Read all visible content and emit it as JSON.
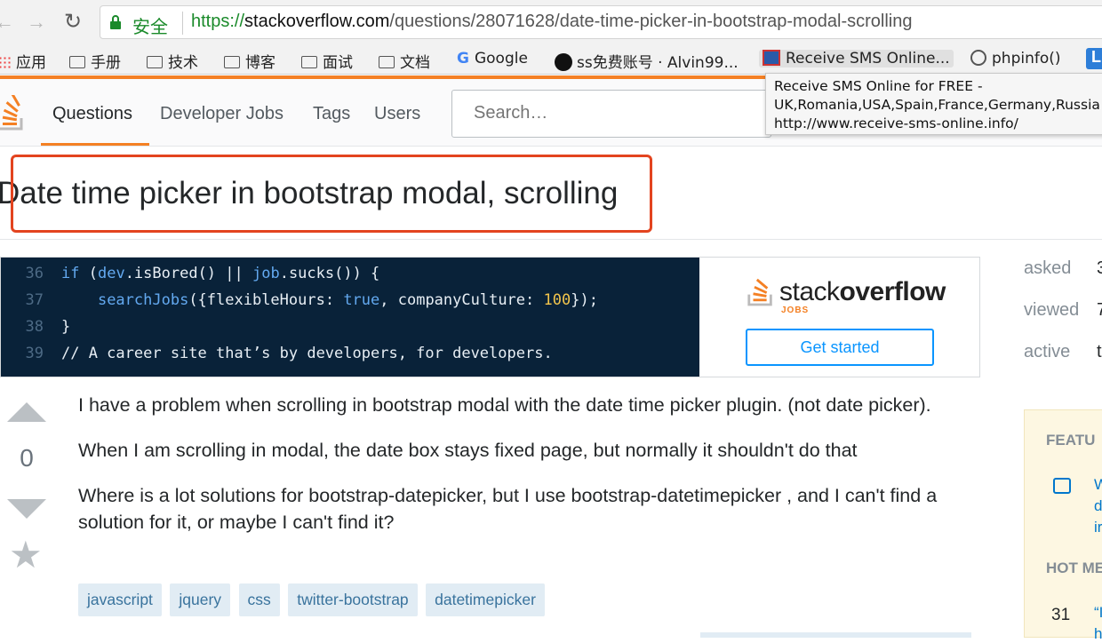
{
  "browser": {
    "secure_label": "安全",
    "url_scheme": "https://",
    "url_host": "stackoverflow.com",
    "url_path": "/questions/28071628/date-time-picker-in-bootstrap-modal-scrolling",
    "bookmarks": [
      "应用",
      "手册",
      "技术",
      "博客",
      "面试",
      "文档",
      "Google",
      "ss免费账号 · Alvin99...",
      "Receive SMS Online...",
      "phpinfo()"
    ],
    "more_badge": "L",
    "tooltip": {
      "line1": "Receive SMS Online for FREE -",
      "line2": "UK,Romania,USA,Spain,France,Germany,Russia",
      "line3": "http://www.receive-sms-online.info/"
    }
  },
  "so_header": {
    "nav": [
      "Questions",
      "Developer Jobs",
      "Tags",
      "Users"
    ],
    "search_placeholder": "Search…"
  },
  "question": {
    "title": "Date time picker in bootstrap modal, scrolling",
    "votes": "0",
    "paragraphs": [
      "I have a problem when scrolling in bootstrap modal with the date time picker plugin. (not date picker).",
      "When I am scrolling in modal, the date box stays fixed page, but normally it shouldn't do that",
      "Where is a lot solutions for bootstrap-datepicker, but I use bootstrap-datetimepicker , and I can't find a solution for it, or maybe I can't find it?"
    ],
    "tags": [
      "javascript",
      "jquery",
      "css",
      "twitter-bootstrap",
      "datetimepicker"
    ]
  },
  "ad": {
    "lines": [
      {
        "num": "36",
        "code": [
          "if",
          " (",
          "dev",
          ".isBored() || ",
          "job",
          ".sucks()) {"
        ]
      },
      {
        "num": "37",
        "code": [
          "searchJobs",
          "({flexibleHours: ",
          "true",
          ", companyCulture: ",
          "100",
          "});"
        ]
      },
      {
        "num": "38",
        "code": [
          "}"
        ]
      },
      {
        "num": "39",
        "code": [
          "// A career site that’s by developers, for developers."
        ]
      }
    ],
    "brand_left": "stack",
    "brand_right": "overflow",
    "brand_sub": "JOBS",
    "cta": "Get started"
  },
  "sidebar": {
    "stats": [
      {
        "label": "asked",
        "value": "3"
      },
      {
        "label": "viewed",
        "value": "7"
      },
      {
        "label": "active",
        "value": "t"
      }
    ],
    "featured_head": "FEATU",
    "featured_link_lines": [
      "W",
      "d",
      "ir"
    ],
    "hot_head": "HOT ME",
    "hot_count": "31",
    "hot_q_lines": [
      "“I",
      "h"
    ]
  },
  "colors": {
    "accent": "#f48024",
    "highlight": "#e3441f",
    "link": "#0077cc",
    "tag_bg": "#e1ecf4"
  }
}
